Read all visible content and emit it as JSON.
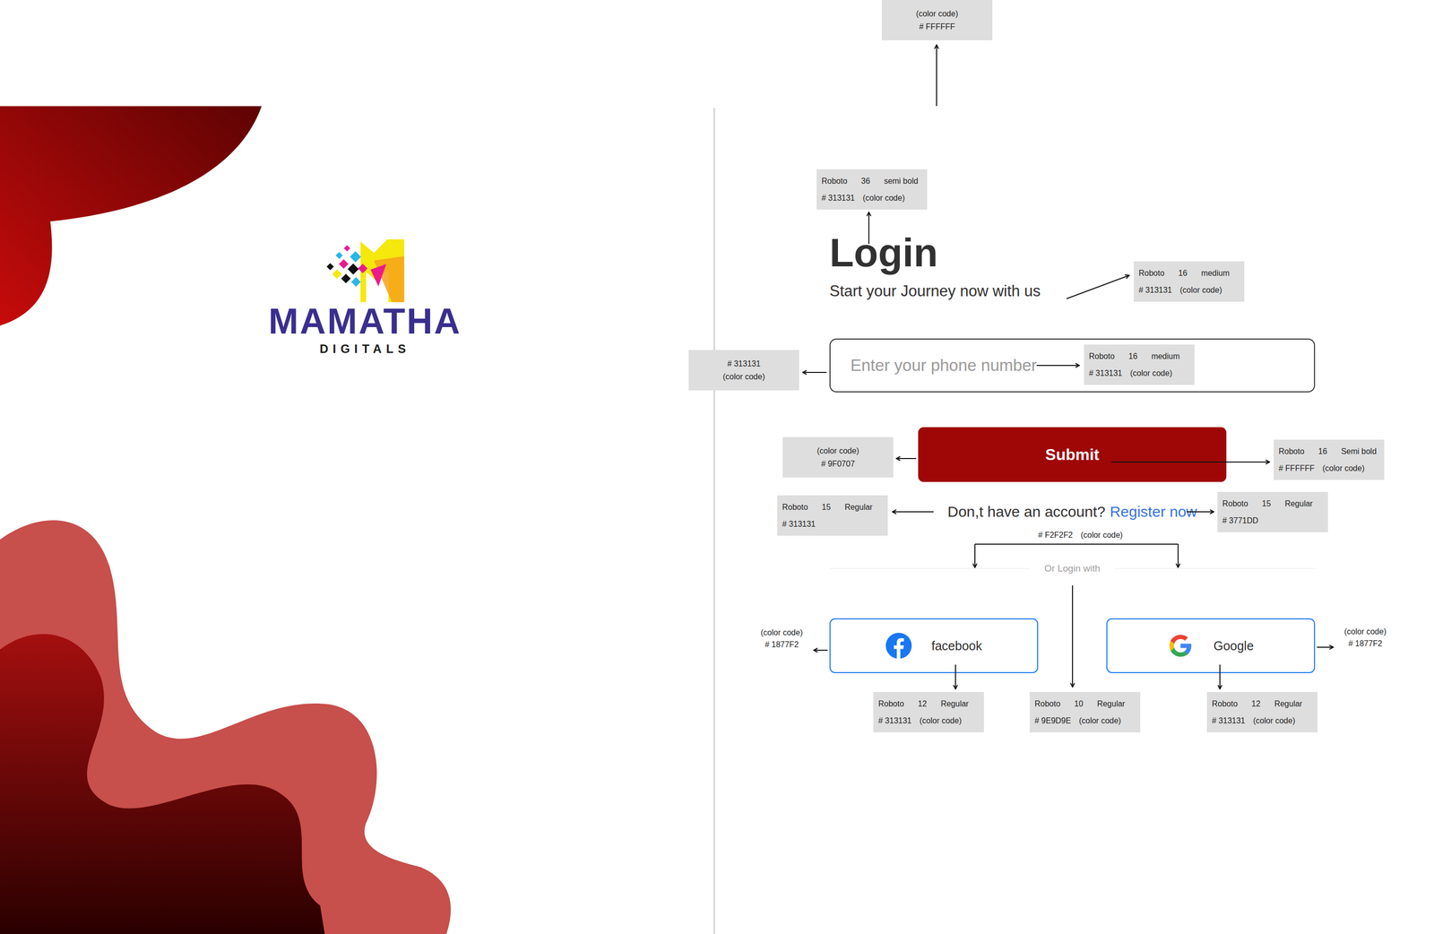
{
  "brand": {
    "name": "MAMATHA",
    "tagline": "DIGITALS"
  },
  "login": {
    "title": "Login",
    "subtitle": "Start your Journey now with us",
    "phone": {
      "placeholder": "Enter your phone number"
    },
    "submit": "Submit",
    "register": {
      "prompt": "Don,t have an account?",
      "link": "Register now"
    },
    "divider": "Or Login with",
    "social": [
      {
        "label": "facebook"
      },
      {
        "label": "Google"
      }
    ]
  },
  "annotations": [
    {
      "kind": "swatch",
      "lines": [
        [
          "(color code)"
        ],
        [
          "# FFFFFF"
        ]
      ]
    },
    {
      "kind": "spec",
      "lines": [
        [
          "Roboto",
          "36",
          "semi bold"
        ],
        [
          "# 313131",
          "(color code)"
        ]
      ]
    },
    {
      "kind": "spec",
      "lines": [
        [
          "Roboto",
          "16",
          "medium"
        ],
        [
          "# 313131",
          "(color code)"
        ]
      ]
    },
    {
      "kind": "swatch",
      "lines": [
        [
          "# 313131"
        ],
        [
          "(color code)"
        ]
      ]
    },
    {
      "kind": "spec",
      "lines": [
        [
          "Roboto",
          "16",
          "medium"
        ],
        [
          "# 313131",
          "(color code)"
        ]
      ]
    },
    {
      "kind": "swatch",
      "lines": [
        [
          "(color code)"
        ],
        [
          "# 9F0707"
        ]
      ]
    },
    {
      "kind": "spec",
      "lines": [
        [
          "Roboto",
          "16",
          "Semi bold"
        ],
        [
          "# FFFFFF",
          "(color code)"
        ]
      ]
    },
    {
      "kind": "spec",
      "lines": [
        [
          "Roboto",
          "15",
          "Regular"
        ],
        [
          "# 313131"
        ]
      ]
    },
    {
      "kind": "spec",
      "lines": [
        [
          "Roboto",
          "15",
          "Regular"
        ],
        [
          "# 3771DD"
        ]
      ]
    },
    {
      "kind": "plain",
      "lines": [
        [
          "# F2F2F2",
          "(color code)"
        ]
      ]
    },
    {
      "kind": "plain",
      "lines": [
        [
          "(color code)"
        ],
        [
          "# 1877F2"
        ]
      ]
    },
    {
      "kind": "plain",
      "lines": [
        [
          "(color code)"
        ],
        [
          "# 1877F2"
        ]
      ]
    },
    {
      "kind": "spec",
      "lines": [
        [
          "Roboto",
          "12",
          "Regular"
        ],
        [
          "# 313131",
          "(color code)"
        ]
      ]
    },
    {
      "kind": "spec",
      "lines": [
        [
          "Roboto",
          "10",
          "Regular"
        ],
        [
          "# 9E9D9E",
          "(color code)"
        ]
      ]
    },
    {
      "kind": "spec",
      "lines": [
        [
          "Roboto",
          "12",
          "Regular"
        ],
        [
          "# 313131",
          "(color code)"
        ]
      ]
    }
  ]
}
